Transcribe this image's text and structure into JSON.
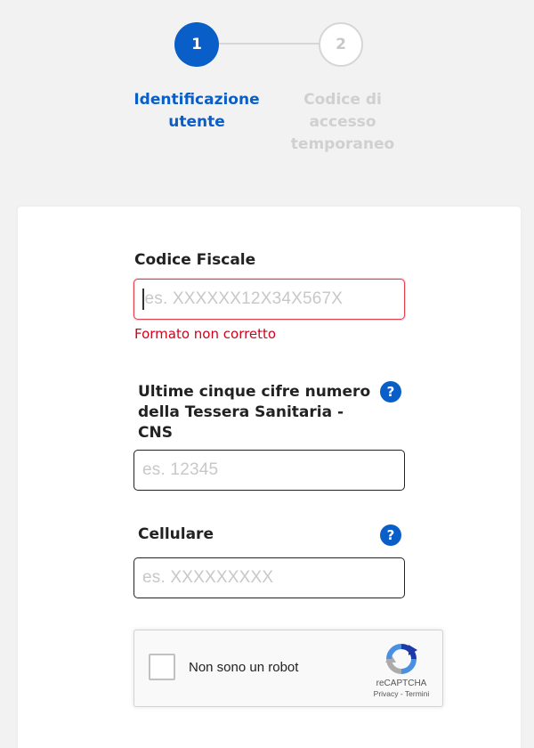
{
  "stepper": {
    "steps": [
      {
        "number": "1",
        "label_line1": "Identificazione",
        "label_line2": "utente",
        "state": "active"
      },
      {
        "number": "2",
        "label_line1": "Codice di",
        "label_line2": "accesso",
        "label_line3": "temporaneo",
        "state": "inactive"
      }
    ]
  },
  "form": {
    "codice_fiscale": {
      "label": "Codice Fiscale",
      "placeholder": "es. XXXXXX12X34X567X",
      "error": "Formato non corretto"
    },
    "tessera": {
      "label_line1": "Ultime cinque cifre numero",
      "label_line2": "della Tessera Sanitaria -",
      "label_line3": "CNS",
      "placeholder": "es. 12345",
      "help": "?"
    },
    "cellulare": {
      "label": "Cellulare",
      "placeholder": "es. XXXXXXXXX",
      "help": "?"
    }
  },
  "recaptcha": {
    "label": "Non sono un robot",
    "brand": "reCAPTCHA",
    "links": "Privacy - Termini"
  },
  "colors": {
    "primary": "#0a5ec8",
    "error": "#d0021b",
    "inactive": "#d0d0d0"
  }
}
